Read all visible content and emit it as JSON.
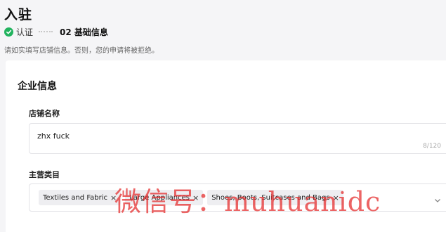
{
  "page": {
    "title": "入驻",
    "notice": "请如实填写店铺信息。否则，您的申请将被拒绝。"
  },
  "steps": {
    "step1": {
      "label": "认证",
      "status": "completed",
      "icon": "check-circle-icon",
      "color": "#22b35e"
    },
    "step2": {
      "label": "02 基础信息",
      "status": "active"
    }
  },
  "form": {
    "section_title": "企业信息",
    "store_name": {
      "label": "店铺名称",
      "value": "zhx fuck",
      "count": "8/120"
    },
    "category": {
      "label": "主营类目",
      "tags": [
        {
          "label": "Textiles and Fabric",
          "remove": "×"
        },
        {
          "label": "Large Appliances",
          "remove": "×"
        },
        {
          "label": "Shoes, Boots, Suitcases and Bags",
          "remove": "×"
        }
      ],
      "dropdown_icon": "chevron-down-icon"
    }
  },
  "watermark": {
    "text": "微信号：muhuanidc",
    "color": "#e42828"
  }
}
